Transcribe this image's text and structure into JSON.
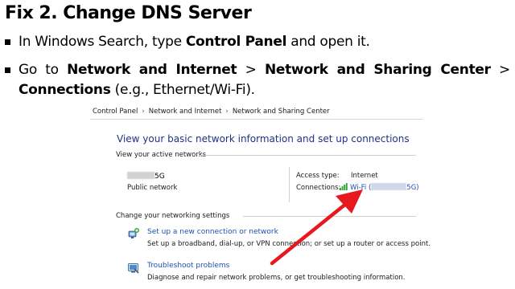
{
  "slide": {
    "title": "Fix 2. Change DNS Server",
    "bullet1": {
      "pre": "In Windows Search, type ",
      "bold": "Control Panel",
      "post": " and open it."
    },
    "bullet2": {
      "seg1": "Go to ",
      "bold1": "Network and Internet",
      "sep1": " > ",
      "bold2": "Network and Sharing Center",
      "sep2": " >",
      "bold3": "Connections",
      "post": " (e.g., Ethernet/Wi-Fi)."
    }
  },
  "control_panel": {
    "breadcrumb": [
      "Control Panel",
      "Network and Internet",
      "Network and Sharing Center"
    ],
    "heading": "View your basic network information and set up connections",
    "active_networks_label": "View your active networks",
    "network_name_suffix": "5G",
    "network_type": "Public network",
    "access_type_label": "Access type:",
    "access_type_value": "Internet",
    "connections_label": "Connections:",
    "connection_prefix": "Wi-Fi (",
    "connection_suffix": "5G)",
    "change_settings_label": "Change your networking settings",
    "actions": [
      {
        "icon": "network-setup-icon",
        "link": "Set up a new connection or network",
        "desc": "Set up a broadband, dial-up, or VPN connection; or set up a router or access point."
      },
      {
        "icon": "troubleshoot-icon",
        "link": "Troubleshoot problems",
        "desc": "Diagnose and repair network problems, or get troubleshooting information."
      }
    ]
  },
  "colors": {
    "heading_blue": "#1e3287",
    "link_blue": "#1e50b4",
    "arrow_red": "#e8191e"
  }
}
